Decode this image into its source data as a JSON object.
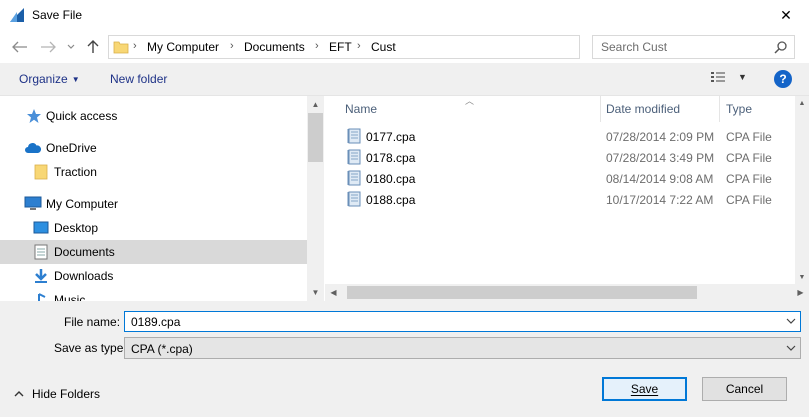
{
  "window": {
    "title": "Save File",
    "close_glyph": "✕"
  },
  "address": {
    "crumbs": [
      "My Computer",
      "Documents",
      "EFT",
      "Cust"
    ],
    "search_placeholder": "Search Cust"
  },
  "toolbar": {
    "organize_label": "Organize",
    "new_folder_label": "New folder",
    "help_label": "?"
  },
  "nav": {
    "items": [
      {
        "label": "Quick access",
        "icon": "star-icon"
      },
      {
        "label": "OneDrive",
        "icon": "cloud-icon"
      },
      {
        "label": "Traction",
        "icon": "folder-icon"
      },
      {
        "label": "My Computer",
        "icon": "computer-icon"
      },
      {
        "label": "Desktop",
        "icon": "desktop-icon"
      },
      {
        "label": "Documents",
        "icon": "documents-icon",
        "selected": true
      },
      {
        "label": "Downloads",
        "icon": "download-icon"
      },
      {
        "label": "Music",
        "icon": "music-icon"
      }
    ]
  },
  "files": {
    "columns": {
      "name": "Name",
      "date": "Date modified",
      "type": "Type"
    },
    "rows": [
      {
        "name": "0177.cpa",
        "date": "07/28/2014 2:09 PM",
        "type": "CPA File"
      },
      {
        "name": "0178.cpa",
        "date": "07/28/2014 3:49 PM",
        "type": "CPA File"
      },
      {
        "name": "0180.cpa",
        "date": "08/14/2014 9:08 AM",
        "type": "CPA File"
      },
      {
        "name": "0188.cpa",
        "date": "10/17/2014 7:22 AM",
        "type": "CPA File"
      }
    ]
  },
  "form": {
    "file_name_label": "File name:",
    "file_name_value": "0189.cpa",
    "save_type_label": "Save as type:",
    "save_type_value": "CPA (*.cpa)",
    "hide_folders_label": "Hide Folders",
    "save_label": "Save",
    "cancel_label": "Cancel"
  },
  "colors": {
    "accent": "#0078d7",
    "link": "#1e3287",
    "selected": "#d9d9d9",
    "help": "#1464c8"
  }
}
